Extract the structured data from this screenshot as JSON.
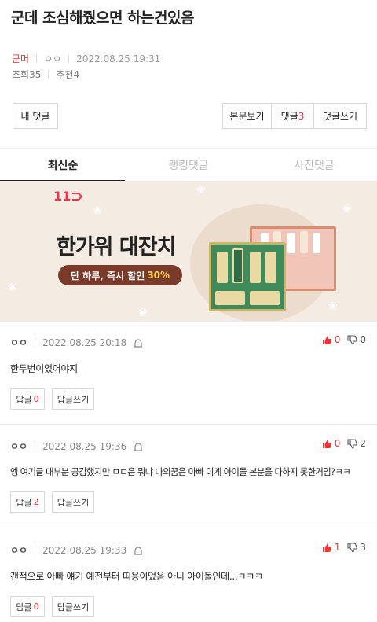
{
  "post": {
    "title": "군데 조심해줬으면 하는건있음",
    "author": "군머",
    "user": "ㅇㅇ",
    "datetime": "2022.08.25 19:31",
    "views_label": "조회",
    "views": "35",
    "recommend_label": "추천",
    "recommend": "4"
  },
  "buttons": {
    "my_comments": "내 댓글",
    "view_post": "본문보기",
    "comments_label": "댓글",
    "comments_count": "3",
    "write_comment": "댓글쓰기"
  },
  "tabs": [
    {
      "label": "최신순",
      "active": true
    },
    {
      "label": "랭킹댓글",
      "active": false
    },
    {
      "label": "사진댓글",
      "active": false
    }
  ],
  "banner": {
    "logo": "11",
    "headline": "한가위 대잔치",
    "sub": "단 하루, 즉시 할인",
    "discount": "30%"
  },
  "comments": [
    {
      "nick": "ㅇㅇ",
      "date": "2022.08.25 20:18",
      "up": "0",
      "down": "0",
      "text": "한두번이었어야지",
      "reply_label": "답글",
      "reply_count": "0",
      "write_reply": "답글쓰기"
    },
    {
      "nick": "ㅇㅇ",
      "date": "2022.08.25 19:36",
      "up": "0",
      "down": "2",
      "text": "엥 여기글 대부분 공감했지만 ㅁㄷ은 뭐냐 나의꿈은 아빠 이게 아이돌 본분을 다하지 못한거임?ㅋㅋ",
      "reply_label": "답글",
      "reply_count": "2",
      "write_reply": "답글쓰기"
    },
    {
      "nick": "ㅇㅇ",
      "date": "2022.08.25 19:33",
      "up": "1",
      "down": "3",
      "text": "갠적으로 아빠 얘기 예전부터 띠용이었음 아니 아이돌인데...ㅋㅋㅋ",
      "reply_label": "답글",
      "reply_count": "0",
      "write_reply": "답글쓰기"
    }
  ],
  "colors": {
    "accent": "#e33333",
    "banner_bg": "#f4ebe2",
    "pill": "#7a3a2a"
  }
}
